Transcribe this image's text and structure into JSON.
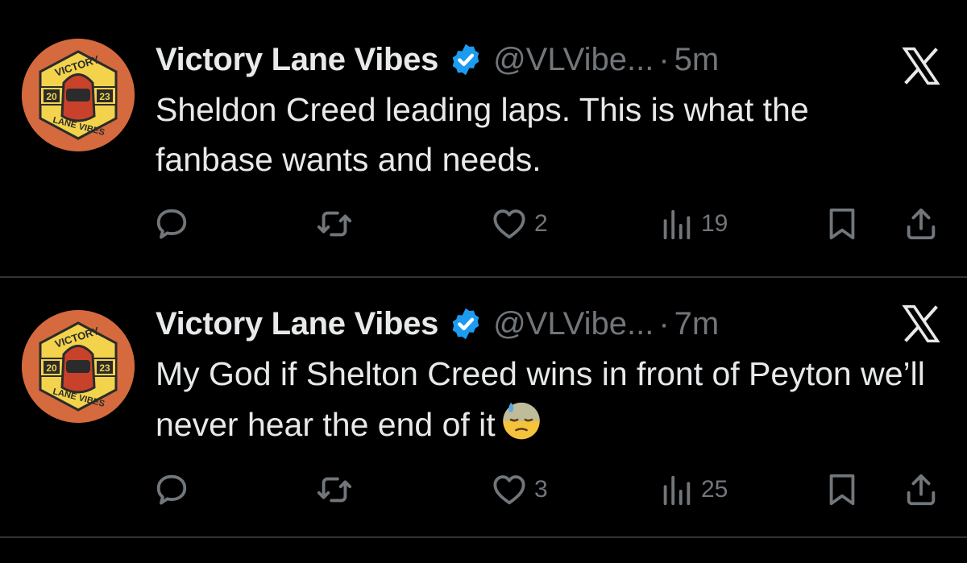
{
  "tweets": [
    {
      "author_name": "Victory Lane Vibes",
      "handle": "@VLVibe...",
      "separator": "·",
      "time": "5m",
      "text": "Sheldon Creed leading laps. This is what the fanbase wants and needs.",
      "emoji": "",
      "likes": "2",
      "views": "19"
    },
    {
      "author_name": "Victory Lane Vibes",
      "handle": "@VLVibe...",
      "separator": "·",
      "time": "7m",
      "text": "My God if Shelton Creed wins in front of Peyton we’ll never hear the end of it",
      "emoji": "downcast-face-with-sweat",
      "likes": "3",
      "views": "25"
    }
  ],
  "avatar": {
    "top_text": "VICTORY",
    "bottom_text": "LANE VIBES",
    "year_left": "20",
    "year_right": "23"
  },
  "icons": {
    "verified": "verified-badge-icon",
    "x_logo": "x-logo-icon",
    "reply": "reply-icon",
    "retweet": "retweet-icon",
    "like": "heart-icon",
    "views": "views-icon",
    "bookmark": "bookmark-icon",
    "share": "share-icon"
  },
  "colors": {
    "background": "#000000",
    "text": "#e7e9ea",
    "secondary": "#71767b",
    "verified": "#1d9bf0",
    "avatar_orange": "#d46a3e",
    "avatar_yellow": "#f2d34b"
  }
}
